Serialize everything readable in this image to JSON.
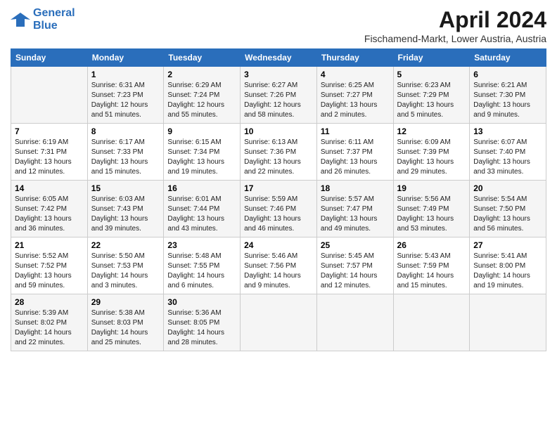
{
  "logo": {
    "line1": "General",
    "line2": "Blue"
  },
  "title": "April 2024",
  "subtitle": "Fischamend-Markt, Lower Austria, Austria",
  "days_header": [
    "Sunday",
    "Monday",
    "Tuesday",
    "Wednesday",
    "Thursday",
    "Friday",
    "Saturday"
  ],
  "weeks": [
    [
      {
        "day": "",
        "info": ""
      },
      {
        "day": "1",
        "info": "Sunrise: 6:31 AM\nSunset: 7:23 PM\nDaylight: 12 hours\nand 51 minutes."
      },
      {
        "day": "2",
        "info": "Sunrise: 6:29 AM\nSunset: 7:24 PM\nDaylight: 12 hours\nand 55 minutes."
      },
      {
        "day": "3",
        "info": "Sunrise: 6:27 AM\nSunset: 7:26 PM\nDaylight: 12 hours\nand 58 minutes."
      },
      {
        "day": "4",
        "info": "Sunrise: 6:25 AM\nSunset: 7:27 PM\nDaylight: 13 hours\nand 2 minutes."
      },
      {
        "day": "5",
        "info": "Sunrise: 6:23 AM\nSunset: 7:29 PM\nDaylight: 13 hours\nand 5 minutes."
      },
      {
        "day": "6",
        "info": "Sunrise: 6:21 AM\nSunset: 7:30 PM\nDaylight: 13 hours\nand 9 minutes."
      }
    ],
    [
      {
        "day": "7",
        "info": "Sunrise: 6:19 AM\nSunset: 7:31 PM\nDaylight: 13 hours\nand 12 minutes."
      },
      {
        "day": "8",
        "info": "Sunrise: 6:17 AM\nSunset: 7:33 PM\nDaylight: 13 hours\nand 15 minutes."
      },
      {
        "day": "9",
        "info": "Sunrise: 6:15 AM\nSunset: 7:34 PM\nDaylight: 13 hours\nand 19 minutes."
      },
      {
        "day": "10",
        "info": "Sunrise: 6:13 AM\nSunset: 7:36 PM\nDaylight: 13 hours\nand 22 minutes."
      },
      {
        "day": "11",
        "info": "Sunrise: 6:11 AM\nSunset: 7:37 PM\nDaylight: 13 hours\nand 26 minutes."
      },
      {
        "day": "12",
        "info": "Sunrise: 6:09 AM\nSunset: 7:39 PM\nDaylight: 13 hours\nand 29 minutes."
      },
      {
        "day": "13",
        "info": "Sunrise: 6:07 AM\nSunset: 7:40 PM\nDaylight: 13 hours\nand 33 minutes."
      }
    ],
    [
      {
        "day": "14",
        "info": "Sunrise: 6:05 AM\nSunset: 7:42 PM\nDaylight: 13 hours\nand 36 minutes."
      },
      {
        "day": "15",
        "info": "Sunrise: 6:03 AM\nSunset: 7:43 PM\nDaylight: 13 hours\nand 39 minutes."
      },
      {
        "day": "16",
        "info": "Sunrise: 6:01 AM\nSunset: 7:44 PM\nDaylight: 13 hours\nand 43 minutes."
      },
      {
        "day": "17",
        "info": "Sunrise: 5:59 AM\nSunset: 7:46 PM\nDaylight: 13 hours\nand 46 minutes."
      },
      {
        "day": "18",
        "info": "Sunrise: 5:57 AM\nSunset: 7:47 PM\nDaylight: 13 hours\nand 49 minutes."
      },
      {
        "day": "19",
        "info": "Sunrise: 5:56 AM\nSunset: 7:49 PM\nDaylight: 13 hours\nand 53 minutes."
      },
      {
        "day": "20",
        "info": "Sunrise: 5:54 AM\nSunset: 7:50 PM\nDaylight: 13 hours\nand 56 minutes."
      }
    ],
    [
      {
        "day": "21",
        "info": "Sunrise: 5:52 AM\nSunset: 7:52 PM\nDaylight: 13 hours\nand 59 minutes."
      },
      {
        "day": "22",
        "info": "Sunrise: 5:50 AM\nSunset: 7:53 PM\nDaylight: 14 hours\nand 3 minutes."
      },
      {
        "day": "23",
        "info": "Sunrise: 5:48 AM\nSunset: 7:55 PM\nDaylight: 14 hours\nand 6 minutes."
      },
      {
        "day": "24",
        "info": "Sunrise: 5:46 AM\nSunset: 7:56 PM\nDaylight: 14 hours\nand 9 minutes."
      },
      {
        "day": "25",
        "info": "Sunrise: 5:45 AM\nSunset: 7:57 PM\nDaylight: 14 hours\nand 12 minutes."
      },
      {
        "day": "26",
        "info": "Sunrise: 5:43 AM\nSunset: 7:59 PM\nDaylight: 14 hours\nand 15 minutes."
      },
      {
        "day": "27",
        "info": "Sunrise: 5:41 AM\nSunset: 8:00 PM\nDaylight: 14 hours\nand 19 minutes."
      }
    ],
    [
      {
        "day": "28",
        "info": "Sunrise: 5:39 AM\nSunset: 8:02 PM\nDaylight: 14 hours\nand 22 minutes."
      },
      {
        "day": "29",
        "info": "Sunrise: 5:38 AM\nSunset: 8:03 PM\nDaylight: 14 hours\nand 25 minutes."
      },
      {
        "day": "30",
        "info": "Sunrise: 5:36 AM\nSunset: 8:05 PM\nDaylight: 14 hours\nand 28 minutes."
      },
      {
        "day": "",
        "info": ""
      },
      {
        "day": "",
        "info": ""
      },
      {
        "day": "",
        "info": ""
      },
      {
        "day": "",
        "info": ""
      }
    ]
  ]
}
